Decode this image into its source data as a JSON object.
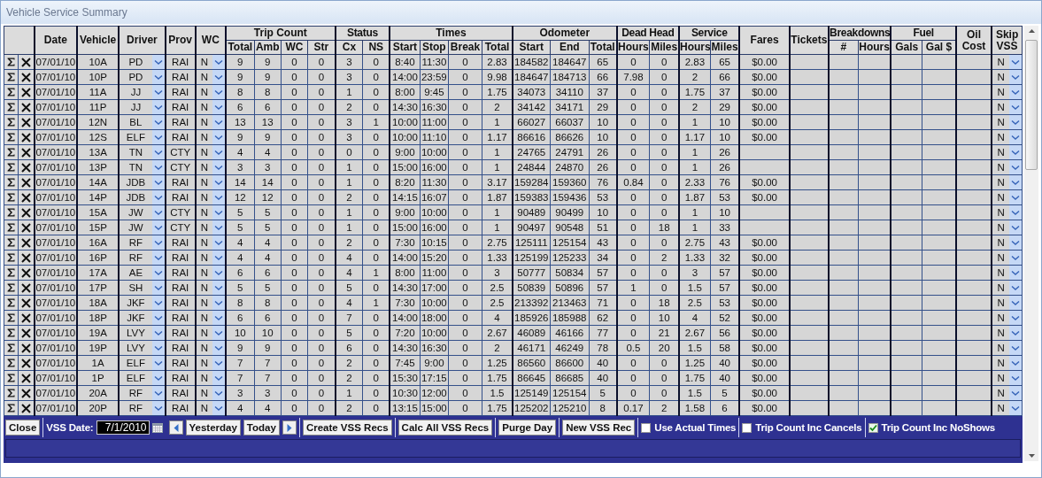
{
  "window": {
    "title": "Vehicle Service Summary"
  },
  "table": {
    "columns": [
      {
        "label": "Date"
      },
      {
        "label": "Vehicle"
      },
      {
        "label": "Driver"
      },
      {
        "label": "Prov"
      },
      {
        "label": "WC"
      },
      {
        "label": "Trip Count",
        "sub": [
          "Total",
          "Amb",
          "WC",
          "Str"
        ]
      },
      {
        "label": "Status",
        "sub": [
          "Cx",
          "NS"
        ]
      },
      {
        "label": "Times",
        "sub": [
          "Start",
          "Stop",
          "Break",
          "Total"
        ]
      },
      {
        "label": "Odometer",
        "sub": [
          "Start",
          "End",
          "Total"
        ]
      },
      {
        "label": "Dead Head",
        "sub": [
          "Hours",
          "Miles"
        ]
      },
      {
        "label": "Service",
        "sub": [
          "Hours",
          "Miles"
        ]
      },
      {
        "label": "Fares"
      },
      {
        "label": "Tickets"
      },
      {
        "label": "Breakdowns",
        "sub": [
          "#",
          "Hours"
        ]
      },
      {
        "label": "Fuel",
        "sub": [
          "Gals",
          "Gal $"
        ]
      },
      {
        "label": "Oil Cost"
      },
      {
        "label": "Skip VSS"
      }
    ],
    "rows": [
      {
        "date": "07/01/10",
        "vehicle": "10A",
        "driver": "PD",
        "prov": "RAI",
        "wc": "N",
        "trip_count": [
          "9",
          "9",
          "0",
          "0"
        ],
        "status": [
          "3",
          "0"
        ],
        "times": [
          "8:40",
          "11:30",
          "0",
          "2.83"
        ],
        "odometer": [
          "184582",
          "184647",
          "65"
        ],
        "dead_head": [
          "0",
          "0"
        ],
        "service": [
          "2.83",
          "65"
        ],
        "fares": "$0.00",
        "skip_vss": "N"
      },
      {
        "date": "07/01/10",
        "vehicle": "10P",
        "driver": "PD",
        "prov": "RAI",
        "wc": "N",
        "trip_count": [
          "9",
          "9",
          "0",
          "0"
        ],
        "status": [
          "3",
          "0"
        ],
        "times": [
          "14:00",
          "23:59",
          "0",
          "9.98"
        ],
        "odometer": [
          "184647",
          "184713",
          "66"
        ],
        "dead_head": [
          "7.98",
          "0"
        ],
        "service": [
          "2",
          "66"
        ],
        "fares": "$0.00",
        "skip_vss": "N"
      },
      {
        "date": "07/01/10",
        "vehicle": "11A",
        "driver": "JJ",
        "prov": "RAI",
        "wc": "N",
        "trip_count": [
          "8",
          "8",
          "0",
          "0"
        ],
        "status": [
          "1",
          "0"
        ],
        "times": [
          "8:00",
          "9:45",
          "0",
          "1.75"
        ],
        "odometer": [
          "34073",
          "34110",
          "37"
        ],
        "dead_head": [
          "0",
          "0"
        ],
        "service": [
          "1.75",
          "37"
        ],
        "fares": "$0.00",
        "skip_vss": "N"
      },
      {
        "date": "07/01/10",
        "vehicle": "11P",
        "driver": "JJ",
        "prov": "RAI",
        "wc": "N",
        "trip_count": [
          "6",
          "6",
          "0",
          "0"
        ],
        "status": [
          "2",
          "0"
        ],
        "times": [
          "14:30",
          "16:30",
          "0",
          "2"
        ],
        "odometer": [
          "34142",
          "34171",
          "29"
        ],
        "dead_head": [
          "0",
          "0"
        ],
        "service": [
          "2",
          "29"
        ],
        "fares": "$0.00",
        "skip_vss": "N"
      },
      {
        "date": "07/01/10",
        "vehicle": "12N",
        "driver": "BL",
        "prov": "RAI",
        "wc": "N",
        "trip_count": [
          "13",
          "13",
          "0",
          "0"
        ],
        "status": [
          "3",
          "1"
        ],
        "times": [
          "10:00",
          "11:00",
          "0",
          "1"
        ],
        "odometer": [
          "66027",
          "66037",
          "10"
        ],
        "dead_head": [
          "0",
          "0"
        ],
        "service": [
          "1",
          "10"
        ],
        "fares": "$0.00",
        "skip_vss": "N"
      },
      {
        "date": "07/01/10",
        "vehicle": "12S",
        "driver": "ELF",
        "prov": "RAI",
        "wc": "N",
        "trip_count": [
          "9",
          "9",
          "0",
          "0"
        ],
        "status": [
          "3",
          "0"
        ],
        "times": [
          "10:00",
          "11:10",
          "0",
          "1.17"
        ],
        "odometer": [
          "86616",
          "86626",
          "10"
        ],
        "dead_head": [
          "0",
          "0"
        ],
        "service": [
          "1.17",
          "10"
        ],
        "fares": "$0.00",
        "skip_vss": "N"
      },
      {
        "date": "07/01/10",
        "vehicle": "13A",
        "driver": "TN",
        "prov": "CTY",
        "wc": "N",
        "trip_count": [
          "4",
          "4",
          "0",
          "0"
        ],
        "status": [
          "0",
          "0"
        ],
        "times": [
          "9:00",
          "10:00",
          "0",
          "1"
        ],
        "odometer": [
          "24765",
          "24791",
          "26"
        ],
        "dead_head": [
          "0",
          "0"
        ],
        "service": [
          "1",
          "26"
        ],
        "skip_vss": "N"
      },
      {
        "date": "07/01/10",
        "vehicle": "13P",
        "driver": "TN",
        "prov": "CTY",
        "wc": "N",
        "trip_count": [
          "3",
          "3",
          "0",
          "0"
        ],
        "status": [
          "1",
          "0"
        ],
        "times": [
          "15:00",
          "16:00",
          "0",
          "1"
        ],
        "odometer": [
          "24844",
          "24870",
          "26"
        ],
        "dead_head": [
          "0",
          "0"
        ],
        "service": [
          "1",
          "26"
        ],
        "skip_vss": "N"
      },
      {
        "date": "07/01/10",
        "vehicle": "14A",
        "driver": "JDB",
        "prov": "RAI",
        "wc": "N",
        "trip_count": [
          "14",
          "14",
          "0",
          "0"
        ],
        "status": [
          "1",
          "0"
        ],
        "times": [
          "8:20",
          "11:30",
          "0",
          "3.17"
        ],
        "odometer": [
          "159284",
          "159360",
          "76"
        ],
        "dead_head": [
          "0.84",
          "0"
        ],
        "service": [
          "2.33",
          "76"
        ],
        "fares": "$0.00",
        "skip_vss": "N"
      },
      {
        "date": "07/01/10",
        "vehicle": "14P",
        "driver": "JDB",
        "prov": "RAI",
        "wc": "N",
        "trip_count": [
          "12",
          "12",
          "0",
          "0"
        ],
        "status": [
          "2",
          "0"
        ],
        "times": [
          "14:15",
          "16:07",
          "0",
          "1.87"
        ],
        "odometer": [
          "159383",
          "159436",
          "53"
        ],
        "dead_head": [
          "0",
          "0"
        ],
        "service": [
          "1.87",
          "53"
        ],
        "fares": "$0.00",
        "skip_vss": "N"
      },
      {
        "date": "07/01/10",
        "vehicle": "15A",
        "driver": "JW",
        "prov": "CTY",
        "wc": "N",
        "trip_count": [
          "5",
          "5",
          "0",
          "0"
        ],
        "status": [
          "1",
          "0"
        ],
        "times": [
          "9:00",
          "10:00",
          "0",
          "1"
        ],
        "odometer": [
          "90489",
          "90499",
          "10"
        ],
        "dead_head": [
          "0",
          "0"
        ],
        "service": [
          "1",
          "10"
        ],
        "skip_vss": "N"
      },
      {
        "date": "07/01/10",
        "vehicle": "15P",
        "driver": "JW",
        "prov": "CTY",
        "wc": "N",
        "trip_count": [
          "5",
          "5",
          "0",
          "0"
        ],
        "status": [
          "1",
          "0"
        ],
        "times": [
          "15:00",
          "16:00",
          "0",
          "1"
        ],
        "odometer": [
          "90497",
          "90548",
          "51"
        ],
        "dead_head": [
          "0",
          "18"
        ],
        "service": [
          "1",
          "33"
        ],
        "skip_vss": "N"
      },
      {
        "date": "07/01/10",
        "vehicle": "16A",
        "driver": "RF",
        "prov": "RAI",
        "wc": "N",
        "trip_count": [
          "4",
          "4",
          "0",
          "0"
        ],
        "status": [
          "2",
          "0"
        ],
        "times": [
          "7:30",
          "10:15",
          "0",
          "2.75"
        ],
        "odometer": [
          "125111",
          "125154",
          "43"
        ],
        "dead_head": [
          "0",
          "0"
        ],
        "service": [
          "2.75",
          "43"
        ],
        "fares": "$0.00",
        "skip_vss": "N"
      },
      {
        "date": "07/01/10",
        "vehicle": "16P",
        "driver": "RF",
        "prov": "RAI",
        "wc": "N",
        "trip_count": [
          "4",
          "4",
          "0",
          "0"
        ],
        "status": [
          "4",
          "0"
        ],
        "times": [
          "14:00",
          "15:20",
          "0",
          "1.33"
        ],
        "odometer": [
          "125199",
          "125233",
          "34"
        ],
        "dead_head": [
          "0",
          "2"
        ],
        "service": [
          "1.33",
          "32"
        ],
        "fares": "$0.00",
        "skip_vss": "N"
      },
      {
        "date": "07/01/10",
        "vehicle": "17A",
        "driver": "AE",
        "prov": "RAI",
        "wc": "N",
        "trip_count": [
          "6",
          "6",
          "0",
          "0"
        ],
        "status": [
          "4",
          "1"
        ],
        "times": [
          "8:00",
          "11:00",
          "0",
          "3"
        ],
        "odometer": [
          "50777",
          "50834",
          "57"
        ],
        "dead_head": [
          "0",
          "0"
        ],
        "service": [
          "3",
          "57"
        ],
        "fares": "$0.00",
        "skip_vss": "N"
      },
      {
        "date": "07/01/10",
        "vehicle": "17P",
        "driver": "SH",
        "prov": "RAI",
        "wc": "N",
        "trip_count": [
          "5",
          "5",
          "0",
          "0"
        ],
        "status": [
          "5",
          "0"
        ],
        "times": [
          "14:30",
          "17:00",
          "0",
          "2.5"
        ],
        "odometer": [
          "50839",
          "50896",
          "57"
        ],
        "dead_head": [
          "1",
          "0"
        ],
        "service": [
          "1.5",
          "57"
        ],
        "fares": "$0.00",
        "skip_vss": "N"
      },
      {
        "date": "07/01/10",
        "vehicle": "18A",
        "driver": "JKF",
        "prov": "RAI",
        "wc": "N",
        "trip_count": [
          "8",
          "8",
          "0",
          "0"
        ],
        "status": [
          "4",
          "1"
        ],
        "times": [
          "7:30",
          "10:00",
          "0",
          "2.5"
        ],
        "odometer": [
          "213392",
          "213463",
          "71"
        ],
        "dead_head": [
          "0",
          "18"
        ],
        "service": [
          "2.5",
          "53"
        ],
        "fares": "$0.00",
        "skip_vss": "N"
      },
      {
        "date": "07/01/10",
        "vehicle": "18P",
        "driver": "JKF",
        "prov": "RAI",
        "wc": "N",
        "trip_count": [
          "6",
          "6",
          "0",
          "0"
        ],
        "status": [
          "7",
          "0"
        ],
        "times": [
          "14:00",
          "18:00",
          "0",
          "4"
        ],
        "odometer": [
          "185926",
          "185988",
          "62"
        ],
        "dead_head": [
          "0",
          "10"
        ],
        "service": [
          "4",
          "52"
        ],
        "fares": "$0.00",
        "skip_vss": "N"
      },
      {
        "date": "07/01/10",
        "vehicle": "19A",
        "driver": "LVY",
        "prov": "RAI",
        "wc": "N",
        "trip_count": [
          "10",
          "10",
          "0",
          "0"
        ],
        "status": [
          "5",
          "0"
        ],
        "times": [
          "7:20",
          "10:00",
          "0",
          "2.67"
        ],
        "odometer": [
          "46089",
          "46166",
          "77"
        ],
        "dead_head": [
          "0",
          "21"
        ],
        "service": [
          "2.67",
          "56"
        ],
        "fares": "$0.00",
        "skip_vss": "N"
      },
      {
        "date": "07/01/10",
        "vehicle": "19P",
        "driver": "LVY",
        "prov": "RAI",
        "wc": "N",
        "trip_count": [
          "9",
          "9",
          "0",
          "0"
        ],
        "status": [
          "6",
          "0"
        ],
        "times": [
          "14:30",
          "16:30",
          "0",
          "2"
        ],
        "odometer": [
          "46171",
          "46249",
          "78"
        ],
        "dead_head": [
          "0.5",
          "20"
        ],
        "service": [
          "1.5",
          "58"
        ],
        "fares": "$0.00",
        "skip_vss": "N"
      },
      {
        "date": "07/01/10",
        "vehicle": "1A",
        "driver": "ELF",
        "prov": "RAI",
        "wc": "N",
        "trip_count": [
          "7",
          "7",
          "0",
          "0"
        ],
        "status": [
          "2",
          "0"
        ],
        "times": [
          "7:45",
          "9:00",
          "0",
          "1.25"
        ],
        "odometer": [
          "86560",
          "86600",
          "40"
        ],
        "dead_head": [
          "0",
          "0"
        ],
        "service": [
          "1.25",
          "40"
        ],
        "fares": "$0.00",
        "skip_vss": "N"
      },
      {
        "date": "07/01/10",
        "vehicle": "1P",
        "driver": "ELF",
        "prov": "RAI",
        "wc": "N",
        "trip_count": [
          "7",
          "7",
          "0",
          "0"
        ],
        "status": [
          "2",
          "0"
        ],
        "times": [
          "15:30",
          "17:15",
          "0",
          "1.75"
        ],
        "odometer": [
          "86645",
          "86685",
          "40"
        ],
        "dead_head": [
          "0",
          "0"
        ],
        "service": [
          "1.75",
          "40"
        ],
        "fares": "$0.00",
        "skip_vss": "N"
      },
      {
        "date": "07/01/10",
        "vehicle": "20A",
        "driver": "RF",
        "prov": "RAI",
        "wc": "N",
        "trip_count": [
          "3",
          "3",
          "0",
          "0"
        ],
        "status": [
          "1",
          "0"
        ],
        "times": [
          "10:30",
          "12:00",
          "0",
          "1.5"
        ],
        "odometer": [
          "125149",
          "125154",
          "5"
        ],
        "dead_head": [
          "0",
          "0"
        ],
        "service": [
          "1.5",
          "5"
        ],
        "fares": "$0.00",
        "skip_vss": "N"
      },
      {
        "date": "07/01/10",
        "vehicle": "20P",
        "driver": "RF",
        "prov": "RAI",
        "wc": "N",
        "trip_count": [
          "4",
          "4",
          "0",
          "0"
        ],
        "status": [
          "2",
          "0"
        ],
        "times": [
          "13:15",
          "15:00",
          "0",
          "1.75"
        ],
        "odometer": [
          "125202",
          "125210",
          "8"
        ],
        "dead_head": [
          "0.17",
          "2"
        ],
        "service": [
          "1.58",
          "6"
        ],
        "fares": "$0.00",
        "skip_vss": "N"
      }
    ]
  },
  "toolbar": {
    "close": "Close",
    "date_label": "VSS Date:",
    "date_value": "7/1/2010",
    "day_buttons": [
      "Yesterday",
      "Today"
    ],
    "actions": [
      "Create VSS Recs",
      "Calc All VSS Recs",
      "Purge Day",
      "New VSS Rec"
    ],
    "options": [
      {
        "label": "Use Actual Times",
        "checked": false
      },
      {
        "label": "Trip Count Inc Cancels",
        "checked": false
      },
      {
        "label": "Trip Count Inc NoShows",
        "checked": true
      }
    ]
  }
}
